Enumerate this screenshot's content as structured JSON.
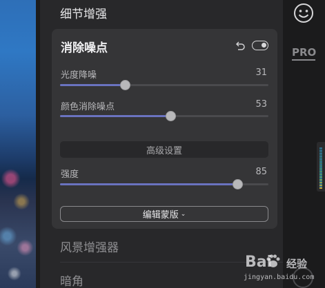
{
  "sections": {
    "detail_enhance": "细节增强",
    "landscape_enhancer": "风景增强器",
    "vignette": "暗角"
  },
  "card": {
    "title": "消除噪点",
    "sliders": [
      {
        "label": "光度降噪",
        "value": "31",
        "level": 0.31
      },
      {
        "label": "颜色消除噪点",
        "value": "53",
        "level": 0.53
      }
    ],
    "advanced_label": "高级设置",
    "strength": {
      "label": "强度",
      "value": "85",
      "level": 0.85
    },
    "mask_label": "编辑蒙版",
    "mask_chevron": "⌄"
  },
  "right": {
    "pro_label": "PRO",
    "smiley_icon": "smiley-face-icon"
  },
  "watermark": {
    "brand": "Bai",
    "brand2": "经验",
    "url": "jingyan.baidu.com"
  },
  "colors": {
    "accent_fill": "#6a73c0",
    "card_bg": "#353537",
    "panel_bg": "#28282a"
  }
}
